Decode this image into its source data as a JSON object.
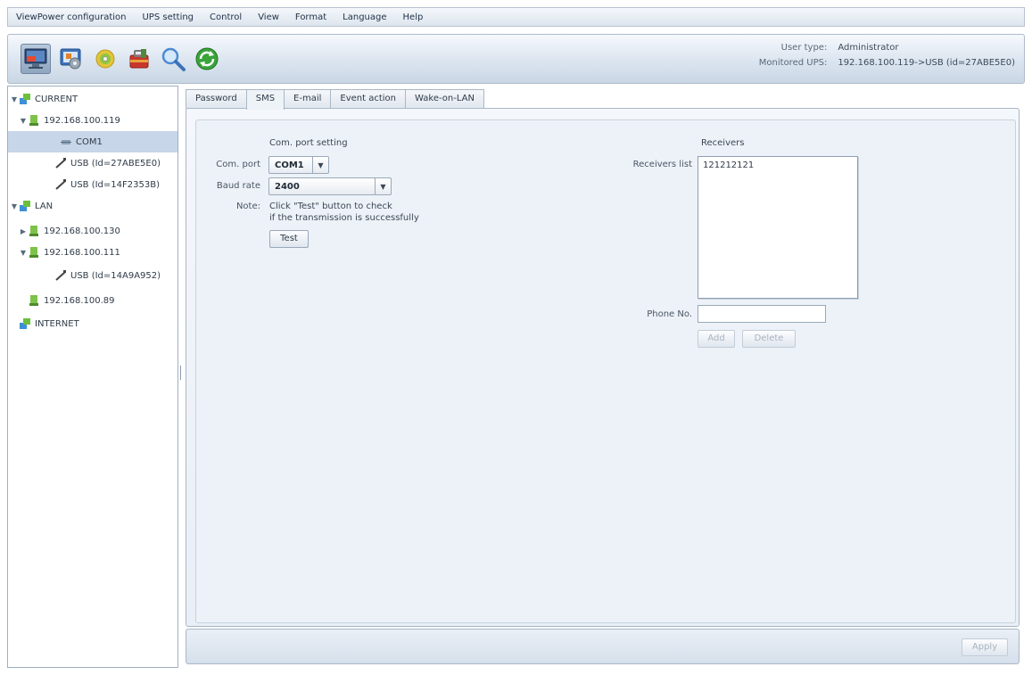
{
  "menu": [
    "ViewPower configuration",
    "UPS setting",
    "Control",
    "View",
    "Format",
    "Language",
    "Help"
  ],
  "toolbar": {
    "user_type_label": "User type:",
    "user_type_value": "Administrator",
    "monitored_label": "Monitored UPS:",
    "monitored_value": "192.168.100.119->USB (id=27ABE5E0)"
  },
  "tree": {
    "current": "CURRENT",
    "host1": "192.168.100.119",
    "com1": "COM1",
    "usb1": "USB (Id=27ABE5E0)",
    "usb2": "USB (Id=14F2353B)",
    "lan": "LAN",
    "host2": "192.168.100.130",
    "host3": "192.168.100.111",
    "usb3": "USB (Id=14A9A952)",
    "host4": "192.168.100.89",
    "internet": "INTERNET"
  },
  "tabs": [
    "Password",
    "SMS",
    "E-mail",
    "Event action",
    "Wake-on-LAN"
  ],
  "sms": {
    "com_section": "Com. port setting",
    "com_port_label": "Com. port",
    "com_port_value": "COM1",
    "baud_label": "Baud rate",
    "baud_value": "2400",
    "note_label": "Note:",
    "note_line1": "Click  \"Test\"  button to check",
    "note_line2": "if the transmission is successfully",
    "test_button": "Test",
    "receivers_section": "Receivers",
    "receivers_list_label": "Receivers list",
    "receivers": [
      "121212121"
    ],
    "phone_label": "Phone No.",
    "phone_value": "",
    "add_button": "Add",
    "delete_button": "Delete"
  },
  "footer": {
    "apply_button": "Apply"
  }
}
